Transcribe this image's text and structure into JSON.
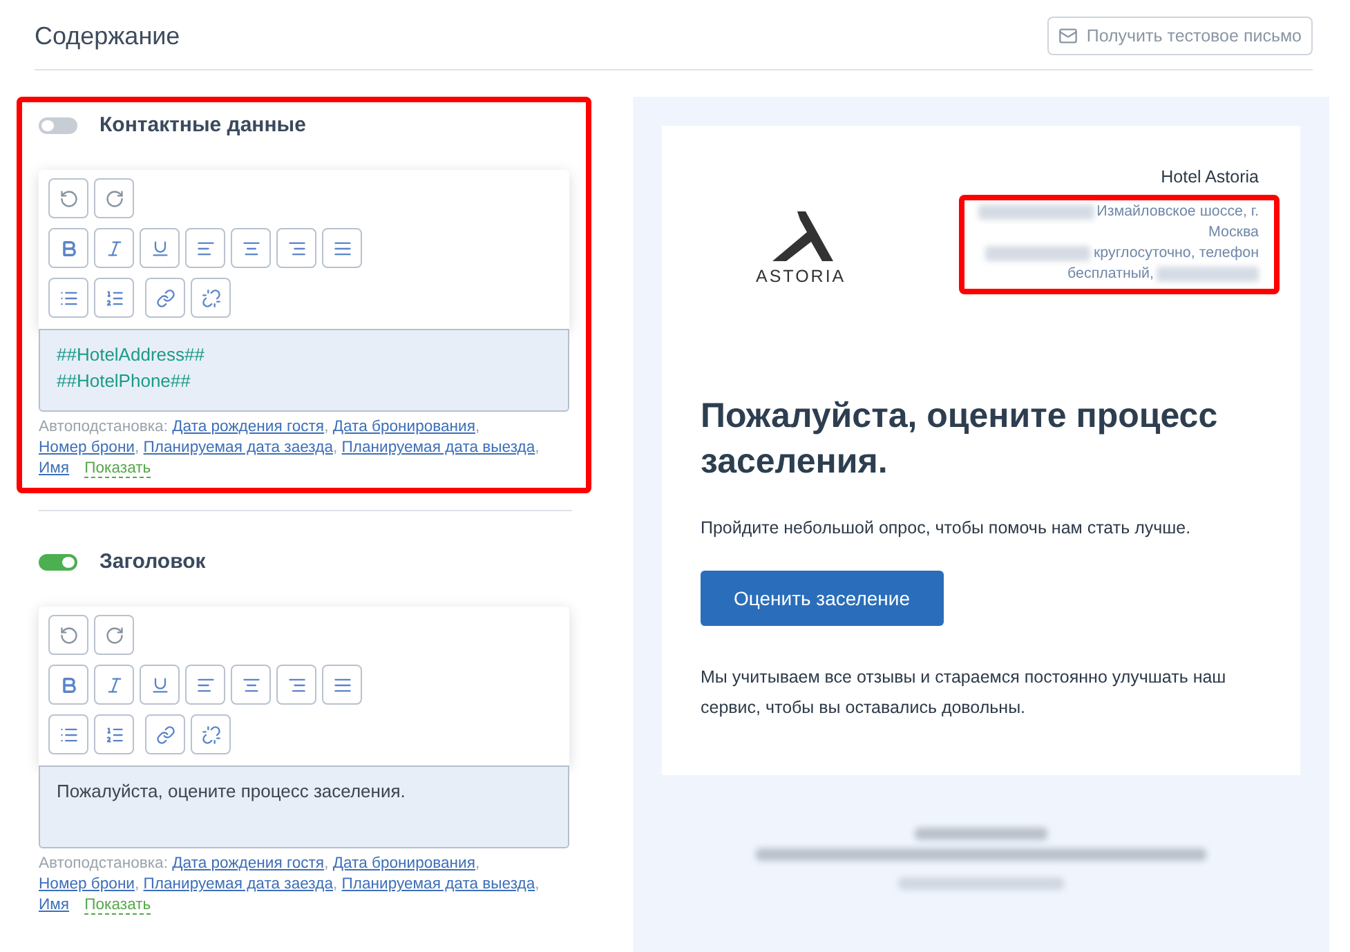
{
  "header": {
    "title": "Содержание",
    "test_button": "Получить тестовое письмо"
  },
  "sections": [
    {
      "title": "Контактные данные",
      "on": false,
      "highlighted": true,
      "lines": [
        {
          "kind": "template",
          "text": "##HotelAddress##"
        },
        {
          "kind": "template",
          "text": "##HotelPhone##"
        }
      ],
      "autofill": {
        "label": "Автоподстановка:",
        "links": [
          {
            "text": "Дата рождения гостя",
            "sep": ","
          },
          {
            "text": "Дата бронирования",
            "sep": ","
          },
          {
            "text": "Номер брони",
            "sep": ","
          },
          {
            "text": "Планируемая дата заезда",
            "sep": ","
          },
          {
            "text": "Планируемая дата выезда",
            "sep": ","
          },
          {
            "text": "Имя"
          }
        ],
        "more": "Показать"
      }
    },
    {
      "title": "Заголовок",
      "on": true,
      "highlighted": false,
      "lines": [
        {
          "kind": "text",
          "text": "Пожалуйста, оцените процесс заселения."
        }
      ],
      "autofill": {
        "label": "Автоподстановка:",
        "links": [
          {
            "text": "Дата рождения гостя",
            "sep": ","
          },
          {
            "text": "Дата бронирования",
            "sep": ","
          },
          {
            "text": "Номер брони",
            "sep": ","
          },
          {
            "text": "Планируемая дата заезда",
            "sep": ","
          },
          {
            "text": "Планируемая дата выезда",
            "sep": ","
          },
          {
            "text": "Имя"
          }
        ],
        "more": "Показать"
      }
    }
  ],
  "preview": {
    "logo_text": "ASTORIA",
    "hotel_name": "Hotel Astoria",
    "contact": {
      "highlighted": true,
      "lines": [
        {
          "parts": [
            {
              "kind": "redacted"
            },
            {
              "kind": "text",
              "text": "Измайловское шоссе, г."
            }
          ]
        },
        {
          "parts": [
            {
              "kind": "text",
              "text": "Москва"
            }
          ]
        },
        {
          "parts": [
            {
              "kind": "redacted"
            },
            {
              "kind": "text",
              "text": "круглосуточно, телефон"
            }
          ]
        },
        {
          "parts": [
            {
              "kind": "text",
              "text": "бесплатный,"
            },
            {
              "kind": "redacted"
            }
          ]
        }
      ]
    },
    "heading": "Пожалуйста, оцените процесс заселения.",
    "intro": "Пройдите небольшой опрос, чтобы помочь нам стать лучше.",
    "button": "Оценить заселение",
    "body": "Мы учитываем все отзывы и стараемся постоянно улучшать наш сервис, чтобы вы оставались довольны.",
    "footer": [
      {
        "kind": "redacted"
      },
      {
        "kind": "redacted_wide"
      },
      {
        "kind": "redacted_link"
      }
    ]
  }
}
